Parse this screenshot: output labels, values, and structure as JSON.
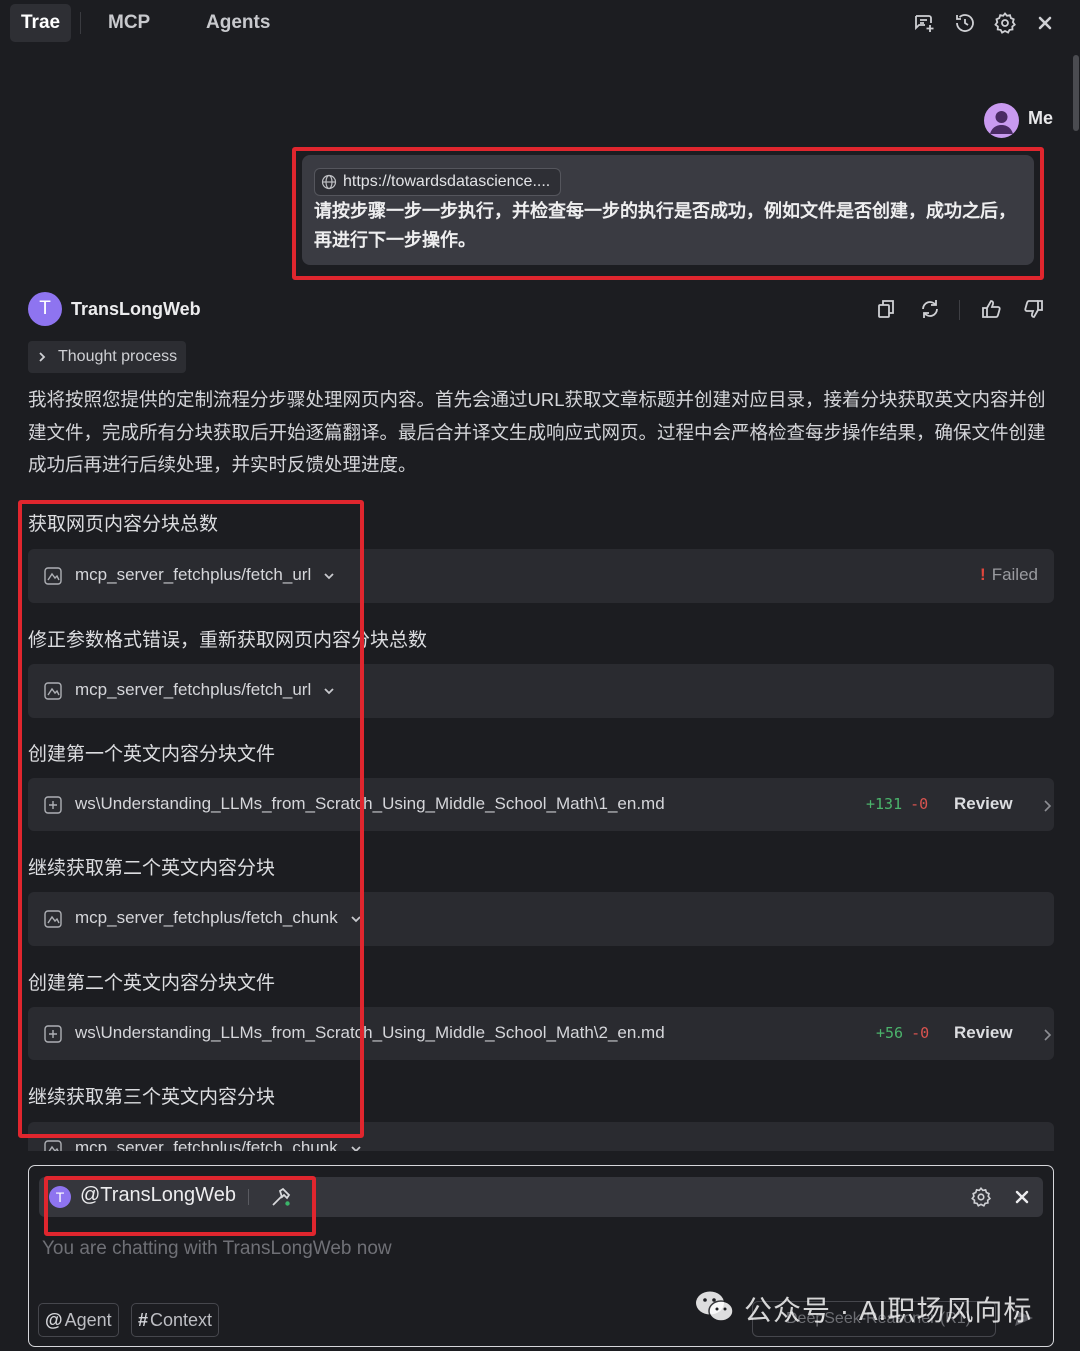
{
  "tabs": [
    {
      "label": "Trae",
      "active": true
    },
    {
      "label": "MCP",
      "active": false
    },
    {
      "label": "Agents",
      "active": false
    }
  ],
  "header_icons": [
    "new-chat-icon",
    "history-icon",
    "settings-icon",
    "close-icon"
  ],
  "user_message": {
    "sender": "Me",
    "url_chip": "https://towardsdatascience....",
    "text": "请按步骤一步一步执行，并检查每一步的执行是否成功，例如文件是否创建，成功之后，再进行下一步操作。"
  },
  "agent": {
    "name": "TransLongWeb",
    "avatar_letter": "T",
    "thought_label": "Thought process",
    "intro": "我将按照您提供的定制流程分步骤处理网页内容。首先会通过URL获取文章标题并创建对应目录，接着分块获取英文内容并创建文件，完成所有分块获取后开始逐篇翻译。最后合并译文生成响应式网页。过程中会严格检查每步操作结果，确保文件创建成功后再进行后续处理，并实时反馈处理进度。"
  },
  "steps": [
    {
      "title": "获取网页内容分块总数",
      "kind": "tool",
      "label": "mcp_server_fetchplus/fetch_url",
      "status": "Failed"
    },
    {
      "title": "修正参数格式错误，重新获取网页内容分块总数",
      "kind": "tool",
      "label": "mcp_server_fetchplus/fetch_url"
    },
    {
      "title": "创建第一个英文内容分块文件",
      "kind": "file",
      "label": "ws\\Understanding_LLMs_from_Scratch_Using_Middle_School_Math\\1_en.md",
      "added": "+131",
      "removed": "-0",
      "review": "Review"
    },
    {
      "title": "继续获取第二个英文内容分块",
      "kind": "tool",
      "label": "mcp_server_fetchplus/fetch_chunk"
    },
    {
      "title": "创建第二个英文内容分块文件",
      "kind": "file",
      "label": "ws\\Understanding_LLMs_from_Scratch_Using_Middle_School_Math\\2_en.md",
      "added": "+56",
      "removed": "-0",
      "review": "Review"
    },
    {
      "title": "继续获取第三个英文内容分块",
      "kind": "tool",
      "label": "mcp_server_fetchplus/fetch_chunk"
    }
  ],
  "input": {
    "mention": "@TransLongWeb",
    "mention_avatar_letter": "T",
    "placeholder": "You are chatting with TransLongWeb now",
    "chip_agent_symbol": "@",
    "chip_agent": "Agent",
    "chip_context_symbol": "#",
    "chip_context": "Context",
    "model": "DeepSeek-Reasoner (R1)"
  },
  "watermark": "公众号 · AI职场风向标",
  "colors": {
    "background": "#1c1d21",
    "card": "#2a2b30",
    "highlight_red": "#e0262e",
    "agent_purple": "#8e74f0",
    "diff_add": "#4bb36b",
    "diff_remove": "#d9534f",
    "failed": "#e0463c"
  }
}
